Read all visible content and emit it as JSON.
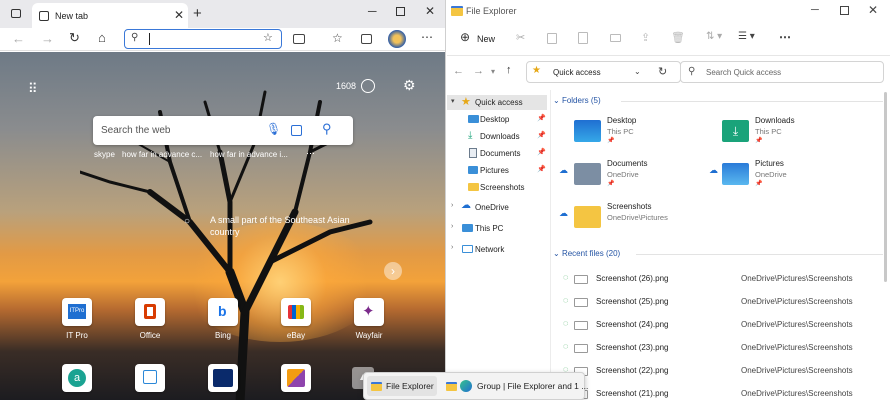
{
  "browser": {
    "tab_title": "New tab",
    "address_value": "",
    "counter": "1608",
    "search_placeholder": "Search the web",
    "quick_links": [
      "skype",
      "how far in advance c...",
      "how far in advance i..."
    ],
    "image_caption": "A small part of the Southeast Asian country",
    "tiles_row1": [
      {
        "label": "IT Pro",
        "icon": "itpro-icon",
        "color": "#1f6fd1"
      },
      {
        "label": "Office",
        "icon": "office-icon",
        "color": "#d83b01"
      },
      {
        "label": "Bing",
        "icon": "bing-icon",
        "color": "#1a73e8"
      },
      {
        "label": "eBay",
        "icon": "ebay-icon",
        "color": "#2b7d2b"
      },
      {
        "label": "Wayfair",
        "icon": "wayfair-icon",
        "color": "#7b2a8b"
      }
    ],
    "tiles_row2": [
      {
        "label": "",
        "icon": "amazon-icon",
        "color": "#1aa392"
      },
      {
        "label": "",
        "icon": "search-tile-icon",
        "color": "#2b88d8"
      },
      {
        "label": "",
        "icon": "disney-icon",
        "color": "#0a2a6b"
      },
      {
        "label": "",
        "icon": "kayak-icon",
        "color": "#c0392b"
      }
    ]
  },
  "explorer": {
    "window_title": "File Explorer",
    "new_button": "New",
    "address": "Quick access",
    "search_placeholder": "Search Quick access",
    "sidebar": [
      {
        "label": "Quick access",
        "icon": "star-icon",
        "indent": 0,
        "selected": true
      },
      {
        "label": "Desktop",
        "icon": "desktop-icon",
        "indent": 1,
        "pinned": true
      },
      {
        "label": "Downloads",
        "icon": "downloads-icon",
        "indent": 1,
        "pinned": true
      },
      {
        "label": "Documents",
        "icon": "documents-icon",
        "indent": 1,
        "pinned": true
      },
      {
        "label": "Pictures",
        "icon": "pictures-icon",
        "indent": 1,
        "pinned": true
      },
      {
        "label": "Screenshots",
        "icon": "folder-icon",
        "indent": 1,
        "pinned": false
      },
      {
        "label": "OneDrive",
        "icon": "onedrive-icon",
        "indent": 0
      },
      {
        "label": "This PC",
        "icon": "thispc-icon",
        "indent": 0
      },
      {
        "label": "Network",
        "icon": "network-icon",
        "indent": 0
      }
    ],
    "folders_header": "Folders (5)",
    "folders": [
      {
        "name": "Desktop",
        "sub": "This PC",
        "icon": "desktop-folder-icon"
      },
      {
        "name": "Downloads",
        "sub": "This PC",
        "icon": "downloads-folder-icon"
      },
      {
        "name": "Documents",
        "sub": "OneDrive",
        "icon": "documents-folder-icon"
      },
      {
        "name": "Pictures",
        "sub": "OneDrive",
        "icon": "pictures-folder-icon"
      },
      {
        "name": "Screenshots",
        "sub": "OneDrive\\Pictures",
        "icon": "screenshots-folder-icon"
      }
    ],
    "recent_header": "Recent files (20)",
    "recent_files": [
      {
        "name": "Screenshot (26).png",
        "location": "OneDrive\\Pictures\\Screenshots"
      },
      {
        "name": "Screenshot (25).png",
        "location": "OneDrive\\Pictures\\Screenshots"
      },
      {
        "name": "Screenshot (24).png",
        "location": "OneDrive\\Pictures\\Screenshots"
      },
      {
        "name": "Screenshot (23).png",
        "location": "OneDrive\\Pictures\\Screenshots"
      },
      {
        "name": "Screenshot (22).png",
        "location": "OneDrive\\Pictures\\Screenshots"
      },
      {
        "name": "Screenshot (21).png",
        "location": "OneDrive\\Pictures\\Screenshots"
      }
    ]
  },
  "taskbar_popup": {
    "item1": "File Explorer",
    "item2": "Group | File Explorer and 1 ..."
  },
  "colors": {
    "accent": "#0067c0",
    "folder": "#f4c542",
    "edge_blue": "#3a78d8"
  }
}
